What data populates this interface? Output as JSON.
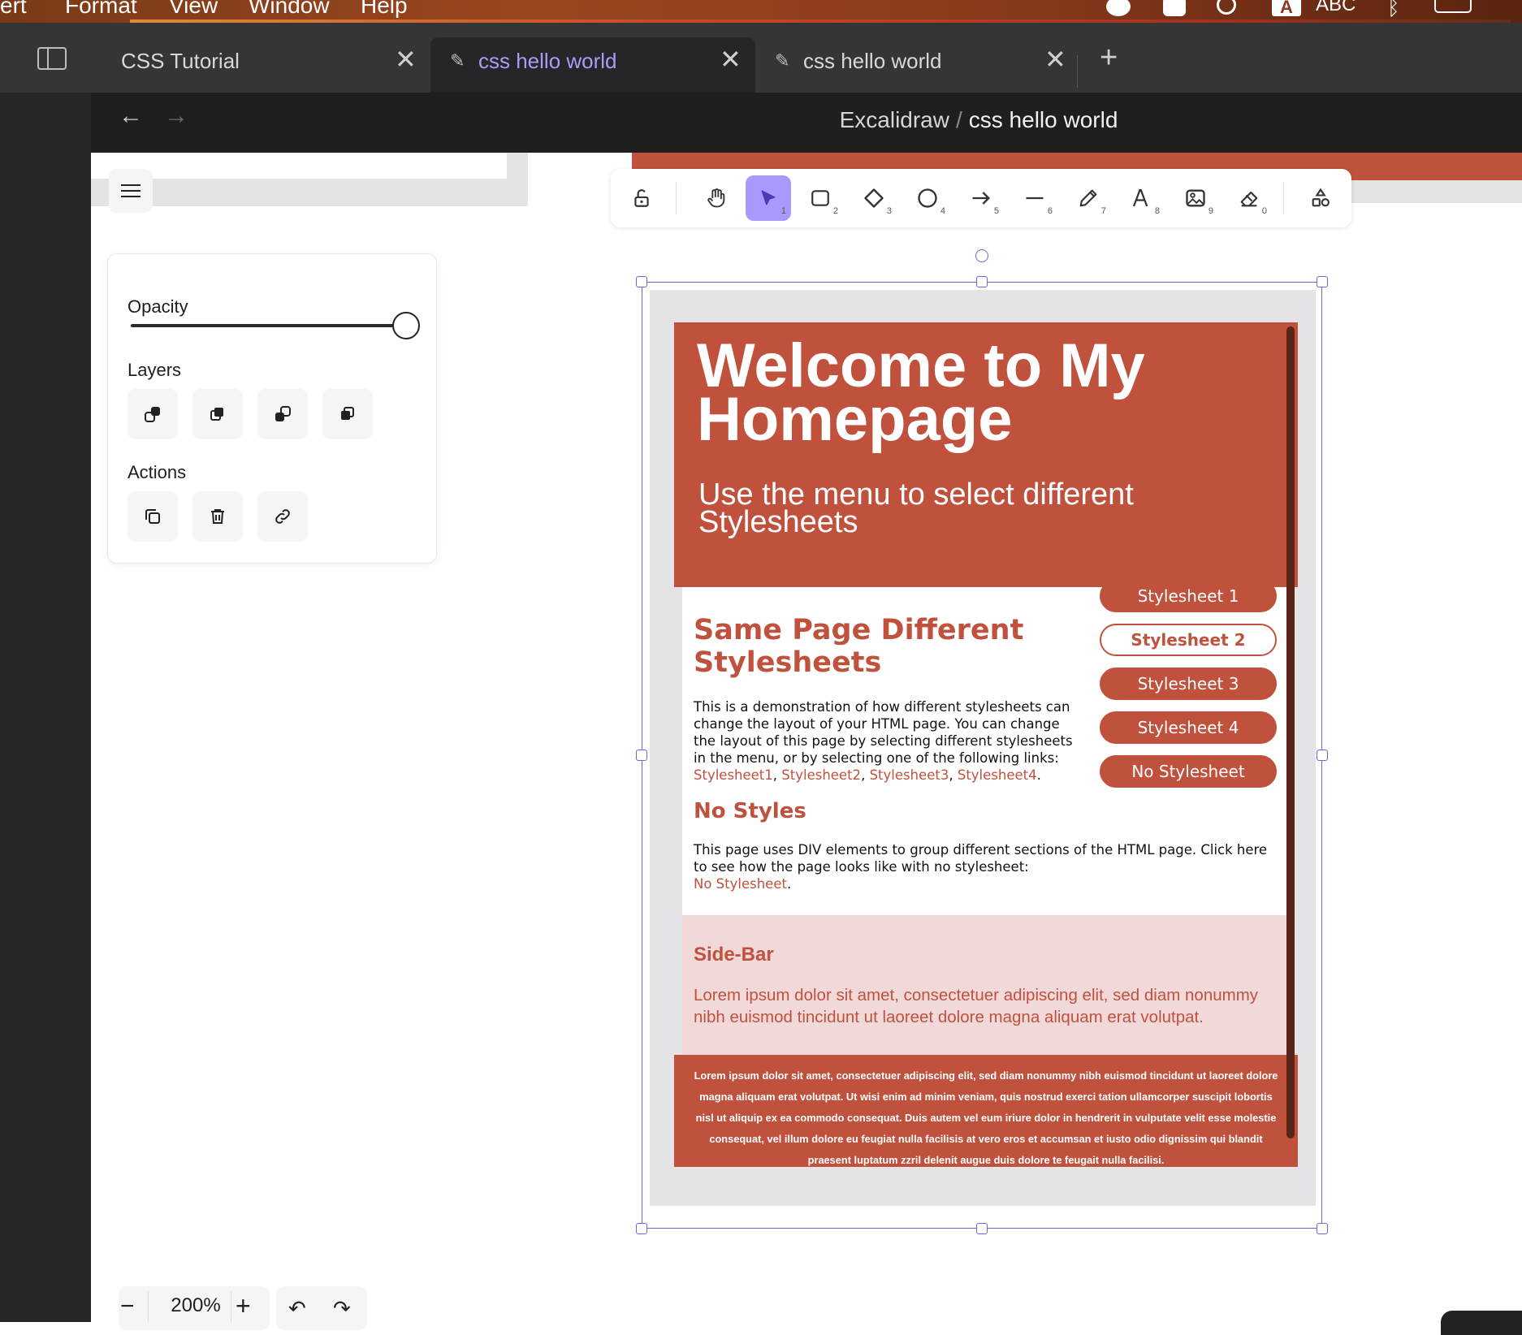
{
  "menubar": {
    "items": [
      "sert",
      "Format",
      "View",
      "Window",
      "Help"
    ],
    "input_source": "A",
    "input_label": "ABC"
  },
  "tabs": [
    {
      "label": "CSS Tutorial",
      "active": false
    },
    {
      "label": "css hello world",
      "active": true
    },
    {
      "label": "css hello world",
      "active": false
    }
  ],
  "breadcrumb": {
    "parent": "Excalidraw",
    "separator": "/",
    "current": "css hello world"
  },
  "properties": {
    "opacity_label": "Opacity",
    "opacity_value": 1.0,
    "layers_label": "Layers",
    "actions_label": "Actions"
  },
  "toolbar": {
    "tools": [
      {
        "name": "lock",
        "key": ""
      },
      {
        "name": "hand",
        "key": ""
      },
      {
        "name": "selection",
        "key": "1"
      },
      {
        "name": "rectangle",
        "key": "2"
      },
      {
        "name": "diamond",
        "key": "3"
      },
      {
        "name": "ellipse",
        "key": "4"
      },
      {
        "name": "arrow",
        "key": "5"
      },
      {
        "name": "line",
        "key": "6"
      },
      {
        "name": "draw",
        "key": "7"
      },
      {
        "name": "text",
        "key": "8"
      },
      {
        "name": "image",
        "key": "9"
      },
      {
        "name": "eraser",
        "key": "0"
      },
      {
        "name": "more-shapes",
        "key": ""
      }
    ],
    "active": "selection"
  },
  "embedded_page": {
    "title": "Welcome to My Homepage",
    "subtitle": "Use the menu to select different Stylesheets",
    "heading": "Same Page Different Stylesheets",
    "intro": "This is a demonstration of how different stylesheets can change the layout of your HTML page. You can change the layout of this page by selecting different stylesheets in the menu, or by selecting one of the following links:",
    "links": [
      "Stylesheet1",
      "Stylesheet2",
      "Stylesheet3",
      "Stylesheet4"
    ],
    "no_styles_heading": "No Styles",
    "no_styles_text": "This page uses DIV elements to group different sections of the HTML page. Click here to see how the page looks like with no stylesheet:",
    "no_styles_link": "No Stylesheet",
    "buttons": [
      "Stylesheet 1",
      "Stylesheet 2",
      "Stylesheet 3",
      "Stylesheet 4",
      "No Stylesheet"
    ],
    "selected_button": "Stylesheet 2",
    "sidebar_title": "Side-Bar",
    "sidebar_text": "Lorem ipsum dolor sit amet, consectetuer adipiscing elit, sed diam nonummy nibh euismod tincidunt ut laoreet dolore magna aliquam erat volutpat.",
    "footer_text": "Lorem ipsum dolor sit amet, consectetuer adipiscing elit, sed diam nonummy nibh euismod tincidunt ut laoreet dolore magna aliquam erat volutpat. Ut wisi enim ad minim veniam, quis nostrud exerci tation ullamcorper suscipit lobortis nisl ut aliquip ex ea commodo consequat. Duis autem vel eum iriure dolor in hendrerit in vulputate velit esse molestie consequat, vel illum dolore eu feugiat nulla facilisis at vero eros et accumsan et iusto odio dignissim qui blandit praesent luptatum zzril delenit augue duis dolore te feugait nulla facilisi."
  },
  "zoom": {
    "value": "200%",
    "minus": "−",
    "plus": "+"
  },
  "colors": {
    "accent": "#6965db",
    "tool_active": "#a89afc",
    "brand_red": "#c0513d",
    "sidebar_pink": "#f1d9d9"
  }
}
